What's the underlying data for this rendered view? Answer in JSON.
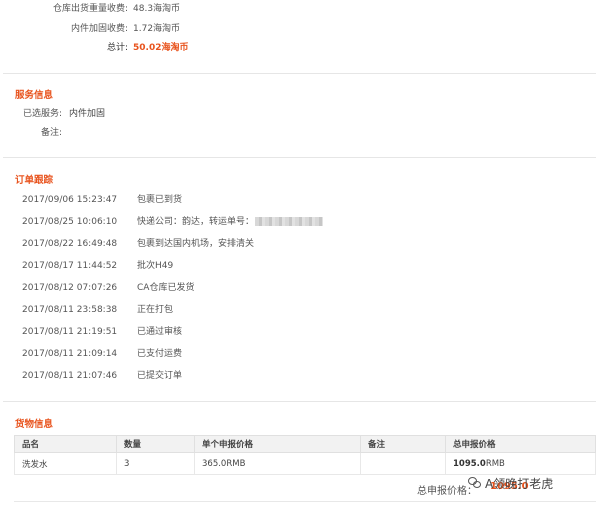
{
  "fees": [
    {
      "label": "仓库出货重量收费:",
      "value": "48.3海淘币"
    },
    {
      "label": "内件加固收费:",
      "value": "1.72海淘币"
    },
    {
      "label": "总计:",
      "value": "50.02海淘币"
    }
  ],
  "service": {
    "title": "服务信息",
    "rows": [
      {
        "label": "已选服务:",
        "value": "内件加固"
      },
      {
        "label": "备注:",
        "value": ""
      }
    ]
  },
  "tracking": {
    "title": "订单跟踪",
    "rows": [
      {
        "time": "2017/09/06 15:23:47",
        "msg": "包裹已到货"
      },
      {
        "time": "2017/08/25 10:06:10",
        "msg": "快递公司：韵达，转运单号："
      },
      {
        "time": "2017/08/22 16:49:48",
        "msg": "包裹到达国内机场，安排清关"
      },
      {
        "time": "2017/08/17 11:44:52",
        "msg": "批次H49"
      },
      {
        "time": "2017/08/12 07:07:26",
        "msg": "CA仓库已发货"
      },
      {
        "time": "2017/08/11 23:58:38",
        "msg": "正在打包"
      },
      {
        "time": "2017/08/11 21:19:51",
        "msg": "已通过审核"
      },
      {
        "time": "2017/08/11 21:09:14",
        "msg": "已支付运费"
      },
      {
        "time": "2017/08/11 21:07:46",
        "msg": "已提交订单"
      }
    ]
  },
  "goods": {
    "title": "货物信息",
    "headers": [
      "品名",
      "数量",
      "单个申报价格",
      "备注",
      "总申报价格"
    ],
    "rows": [
      {
        "name": "洗发水",
        "qty": "3",
        "unit_price": "365.0RMB",
        "note": "",
        "total_num": "1095.0",
        "total_unit": "RMB"
      }
    ],
    "summary_label": "总申报价格：",
    "summary_value": "1095.0"
  },
  "watermark": {
    "text": "A领晚打老虎"
  }
}
